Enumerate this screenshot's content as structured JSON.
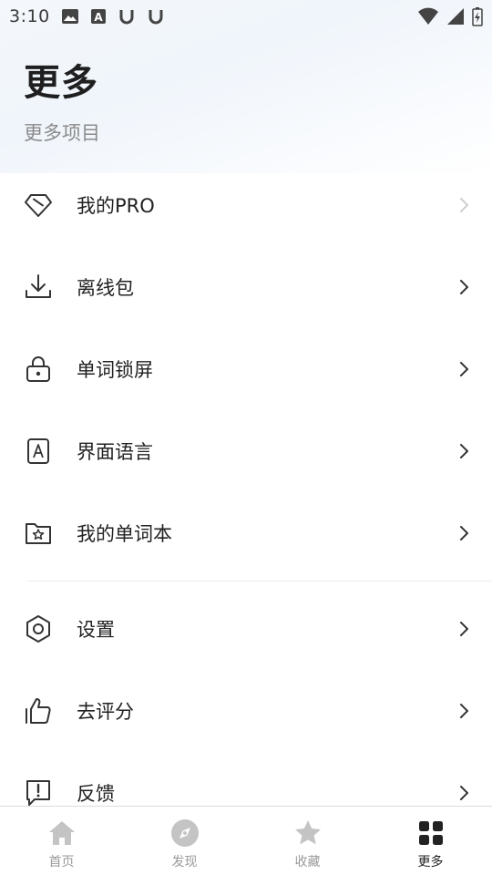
{
  "status_bar": {
    "time": "3:10",
    "left_icons": [
      "image-icon",
      "a-box-icon",
      "u-icon",
      "u-icon"
    ],
    "right_icons": [
      "wifi-icon",
      "signal-icon",
      "battery-charging-icon"
    ]
  },
  "header": {
    "title": "更多",
    "subtitle": "更多项目"
  },
  "menu": {
    "group1": [
      {
        "label": "我的PRO",
        "icon": "diamond-icon",
        "chevron_color": "#cfcfcf"
      },
      {
        "label": "离线包",
        "icon": "download-icon",
        "chevron_color": "#333333"
      },
      {
        "label": "单词锁屏",
        "icon": "lock-icon",
        "chevron_color": "#333333"
      },
      {
        "label": "界面语言",
        "icon": "language-a-icon",
        "chevron_color": "#333333"
      },
      {
        "label": "我的单词本",
        "icon": "folder-star-icon",
        "chevron_color": "#333333"
      }
    ],
    "group2": [
      {
        "label": "设置",
        "icon": "settings-hex-icon",
        "chevron_color": "#333333"
      },
      {
        "label": "去评分",
        "icon": "thumbs-up-icon",
        "chevron_color": "#333333"
      },
      {
        "label": "反馈",
        "icon": "feedback-icon",
        "chevron_color": "#333333"
      }
    ]
  },
  "tab_bar": {
    "tabs": [
      {
        "label": "首页",
        "icon": "home-icon",
        "active": false
      },
      {
        "label": "发现",
        "icon": "compass-icon",
        "active": false
      },
      {
        "label": "收藏",
        "icon": "star-icon",
        "active": false
      },
      {
        "label": "更多",
        "icon": "grid-icon",
        "active": true
      }
    ],
    "inactive_color": "#c4c4c4",
    "active_color": "#222222"
  }
}
